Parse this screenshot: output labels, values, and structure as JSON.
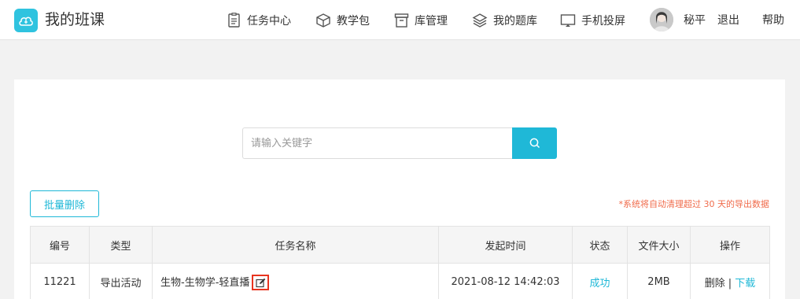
{
  "header": {
    "title": "我的班课",
    "nav": [
      {
        "label": "任务中心",
        "icon": "document-icon"
      },
      {
        "label": "教学包",
        "icon": "package-icon"
      },
      {
        "label": "库管理",
        "icon": "archive-icon"
      },
      {
        "label": "我的题库",
        "icon": "layers-icon"
      },
      {
        "label": "手机投屏",
        "icon": "screen-cast-icon"
      }
    ],
    "username": "秘平",
    "logout": "退出",
    "help": "帮助"
  },
  "search": {
    "placeholder": "请输入关键字"
  },
  "toolbar": {
    "batch_delete": "批量删除",
    "notice": "*系统将自动清理超过 30 天的导出数据"
  },
  "table": {
    "columns": [
      "编号",
      "类型",
      "任务名称",
      "发起时间",
      "状态",
      "文件大小",
      "操作"
    ],
    "rows": [
      {
        "id": "11221",
        "type": "导出活动",
        "name": "生物-生物学-轻直播",
        "time": "2021-08-12 14:42:03",
        "status": "成功",
        "size": "2MB",
        "op_delete": "删除",
        "op_sep": "|",
        "op_download": "下载"
      }
    ]
  },
  "colors": {
    "accent": "#1fb8d7",
    "notice": "#f06b4b",
    "highlight": "#e8341f"
  }
}
